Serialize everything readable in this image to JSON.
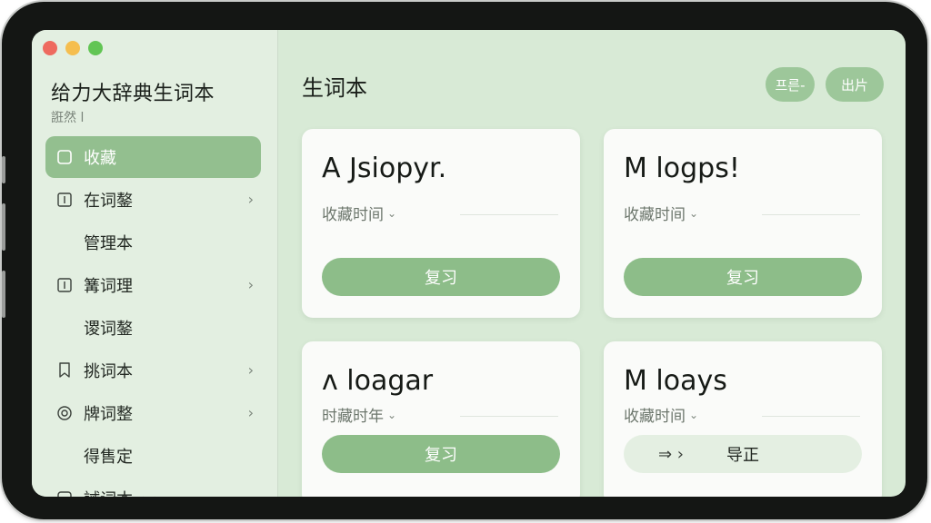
{
  "colors": {
    "accent": "#8dbd89",
    "sidebar_bg": "#e3efe1",
    "main_bg": "#d8ead6",
    "traffic_red": "#ee6a5f",
    "traffic_yellow": "#f5be4f",
    "traffic_green": "#62c554"
  },
  "sidebar": {
    "app_title": "给力大辞典生词本",
    "app_subtitle": "誑然 l",
    "items": [
      {
        "label": "收藏",
        "icon": "note-icon",
        "active": true
      },
      {
        "label": "在词鏊",
        "icon": "calendar-icon",
        "chevron": true
      },
      {
        "label": "管理本",
        "sub": true
      },
      {
        "label": "篝词理",
        "icon": "calendar-icon",
        "chevron": true
      },
      {
        "label": "谡词鏊",
        "sub": true
      },
      {
        "label": "挑词本",
        "icon": "bookmark-icon",
        "chevron": true
      },
      {
        "label": "牌词整",
        "icon": "circle-icon",
        "chevron": true
      },
      {
        "label": "得售定",
        "sub": true
      },
      {
        "label": "誡词本 ‹ ‹",
        "icon": "note-icon"
      }
    ]
  },
  "main": {
    "title": "生词本",
    "header_buttons": [
      "프른-",
      "出片"
    ],
    "cards": [
      {
        "word": "A Jsiopyr.",
        "meta": "收藏时间",
        "button": "复习"
      },
      {
        "word": "M logps!",
        "meta": "收藏时间",
        "button": "复习"
      },
      {
        "word": "ʌ loagar",
        "meta": "时藏时年",
        "button": "复习"
      },
      {
        "word": "M loays",
        "meta": "收藏时间",
        "button": "导正",
        "button_prefix": "⇒ ›"
      }
    ]
  }
}
